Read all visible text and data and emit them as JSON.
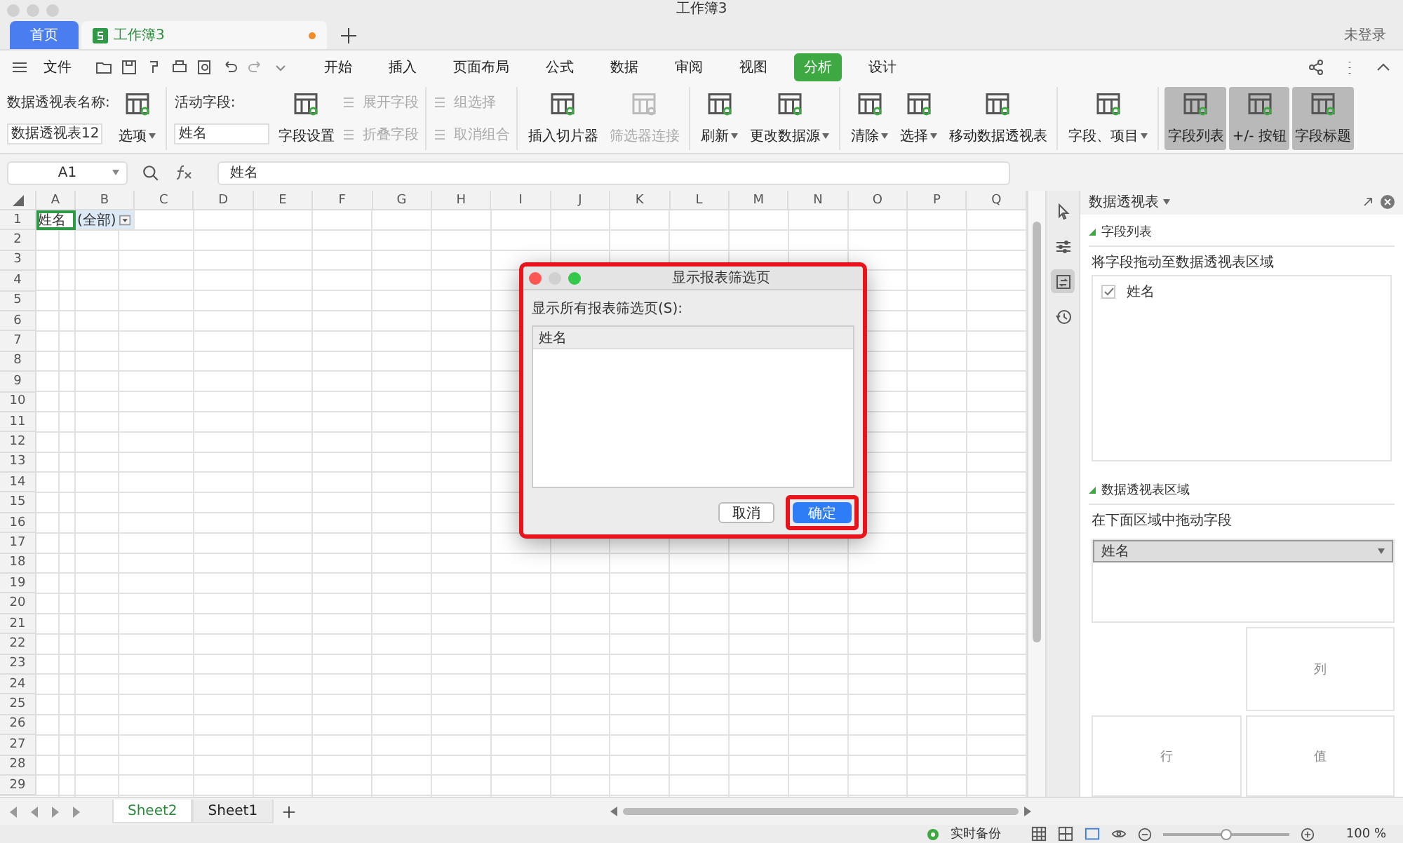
{
  "window": {
    "title": "工作簿3"
  },
  "doc_tabs": [
    {
      "label": "首页",
      "kind": "home",
      "selected": false
    },
    {
      "label": "工作簿3",
      "kind": "sheet",
      "selected": true,
      "unsaved": true
    }
  ],
  "account": "未登录",
  "menu": {
    "file": "文件",
    "tabs": [
      {
        "label": "开始",
        "selected": false
      },
      {
        "label": "插入",
        "selected": false
      },
      {
        "label": "页面布局",
        "selected": false
      },
      {
        "label": "公式",
        "selected": false
      },
      {
        "label": "数据",
        "selected": false
      },
      {
        "label": "审阅",
        "selected": false
      },
      {
        "label": "视图",
        "selected": false
      },
      {
        "label": "分析",
        "selected": true
      },
      {
        "label": "设计",
        "selected": false
      }
    ]
  },
  "ribbon": [
    {
      "items": [
        {
          "kind": "field",
          "label": "数据透视表名称:",
          "value": "数据透视表12"
        },
        {
          "kind": "big",
          "label": "选项",
          "dropdown": true,
          "disabled": false
        }
      ]
    },
    {
      "items": [
        {
          "kind": "field",
          "label": "活动字段:",
          "value": "姓名"
        },
        {
          "kind": "big",
          "label": "字段设置",
          "dropdown": false,
          "disabled": false
        },
        {
          "kind": "stack",
          "items": [
            {
              "label": "展开字段",
              "disabled": true
            },
            {
              "label": "折叠字段",
              "disabled": true
            }
          ]
        }
      ]
    },
    {
      "items": [
        {
          "kind": "stack",
          "items": [
            {
              "label": "组选择",
              "disabled": true
            },
            {
              "label": "取消组合",
              "disabled": true
            }
          ]
        }
      ]
    },
    {
      "items": [
        {
          "kind": "big",
          "label": "插入切片器",
          "dropdown": false,
          "disabled": false
        },
        {
          "kind": "big",
          "label": "筛选器连接",
          "dropdown": false,
          "disabled": true
        }
      ]
    },
    {
      "items": [
        {
          "kind": "big",
          "label": "刷新",
          "dropdown": true,
          "disabled": false
        },
        {
          "kind": "big",
          "label": "更改数据源",
          "dropdown": true,
          "disabled": false
        }
      ]
    },
    {
      "items": [
        {
          "kind": "big",
          "label": "清除",
          "dropdown": true,
          "disabled": false
        },
        {
          "kind": "big",
          "label": "选择",
          "dropdown": true,
          "disabled": false
        },
        {
          "kind": "big",
          "label": "移动数据透视表",
          "dropdown": false,
          "disabled": false
        }
      ]
    },
    {
      "items": [
        {
          "kind": "big",
          "label": "字段、项目",
          "dropdown": true,
          "disabled": false
        }
      ]
    },
    {
      "items": [
        {
          "kind": "toggle",
          "label": "字段列表",
          "on": true
        },
        {
          "kind": "toggle",
          "label": "+/- 按钮",
          "on": true
        },
        {
          "kind": "toggle",
          "label": "字段标题",
          "on": true
        }
      ]
    }
  ],
  "formula_bar": {
    "cell": "A1",
    "formula": "姓名"
  },
  "sheet": {
    "columns": [
      "A",
      "B",
      "C",
      "D",
      "E",
      "F",
      "G",
      "H",
      "I",
      "J",
      "K",
      "L",
      "M",
      "N",
      "O",
      "P",
      "Q"
    ],
    "row_numbers": [
      "1",
      "2",
      "3",
      "4",
      "5",
      "6",
      "7",
      "8",
      "9",
      "10",
      "11",
      "12",
      "13",
      "14",
      "15",
      "16",
      "17",
      "18",
      "19",
      "20",
      "21",
      "22",
      "23",
      "24",
      "25",
      "26",
      "27",
      "28",
      "29"
    ],
    "cells": [
      {
        "text": "姓名",
        "selected": true,
        "filter": false
      },
      {
        "text": "(全部)",
        "selected": false,
        "filter": true
      }
    ]
  },
  "side_tools": [
    {
      "kind": "pointer",
      "selected": false
    },
    {
      "kind": "properties",
      "selected": false
    },
    {
      "kind": "pivot",
      "selected": true
    },
    {
      "kind": "history",
      "selected": false
    }
  ],
  "panel": {
    "title": "数据透视表",
    "field_list": {
      "title": "字段列表",
      "hint": "将字段拖动至数据透视表区域",
      "fields": [
        {
          "label": "姓名",
          "checked": true
        }
      ]
    },
    "areas": {
      "title": "数据透视表区域",
      "hint": "在下面区域中拖动字段",
      "filter_fields": [
        "姓名"
      ],
      "column_label": "列",
      "row_label": "行",
      "value_label": "值"
    }
  },
  "dialog": {
    "title": "显示报表筛选页",
    "annotated": true,
    "label": "显示所有报表筛选页(S):",
    "list_header": "姓名",
    "buttons": [
      {
        "label": "取消",
        "kind": "cancel",
        "annotated": false
      },
      {
        "label": "确定",
        "kind": "default",
        "annotated": true
      }
    ]
  },
  "sheets": [
    {
      "label": "Sheet2",
      "selected": true
    },
    {
      "label": "Sheet1",
      "selected": false
    }
  ],
  "status": {
    "backup": "实时备份",
    "zoom": {
      "level": 0.5,
      "reading": "100 %"
    }
  }
}
